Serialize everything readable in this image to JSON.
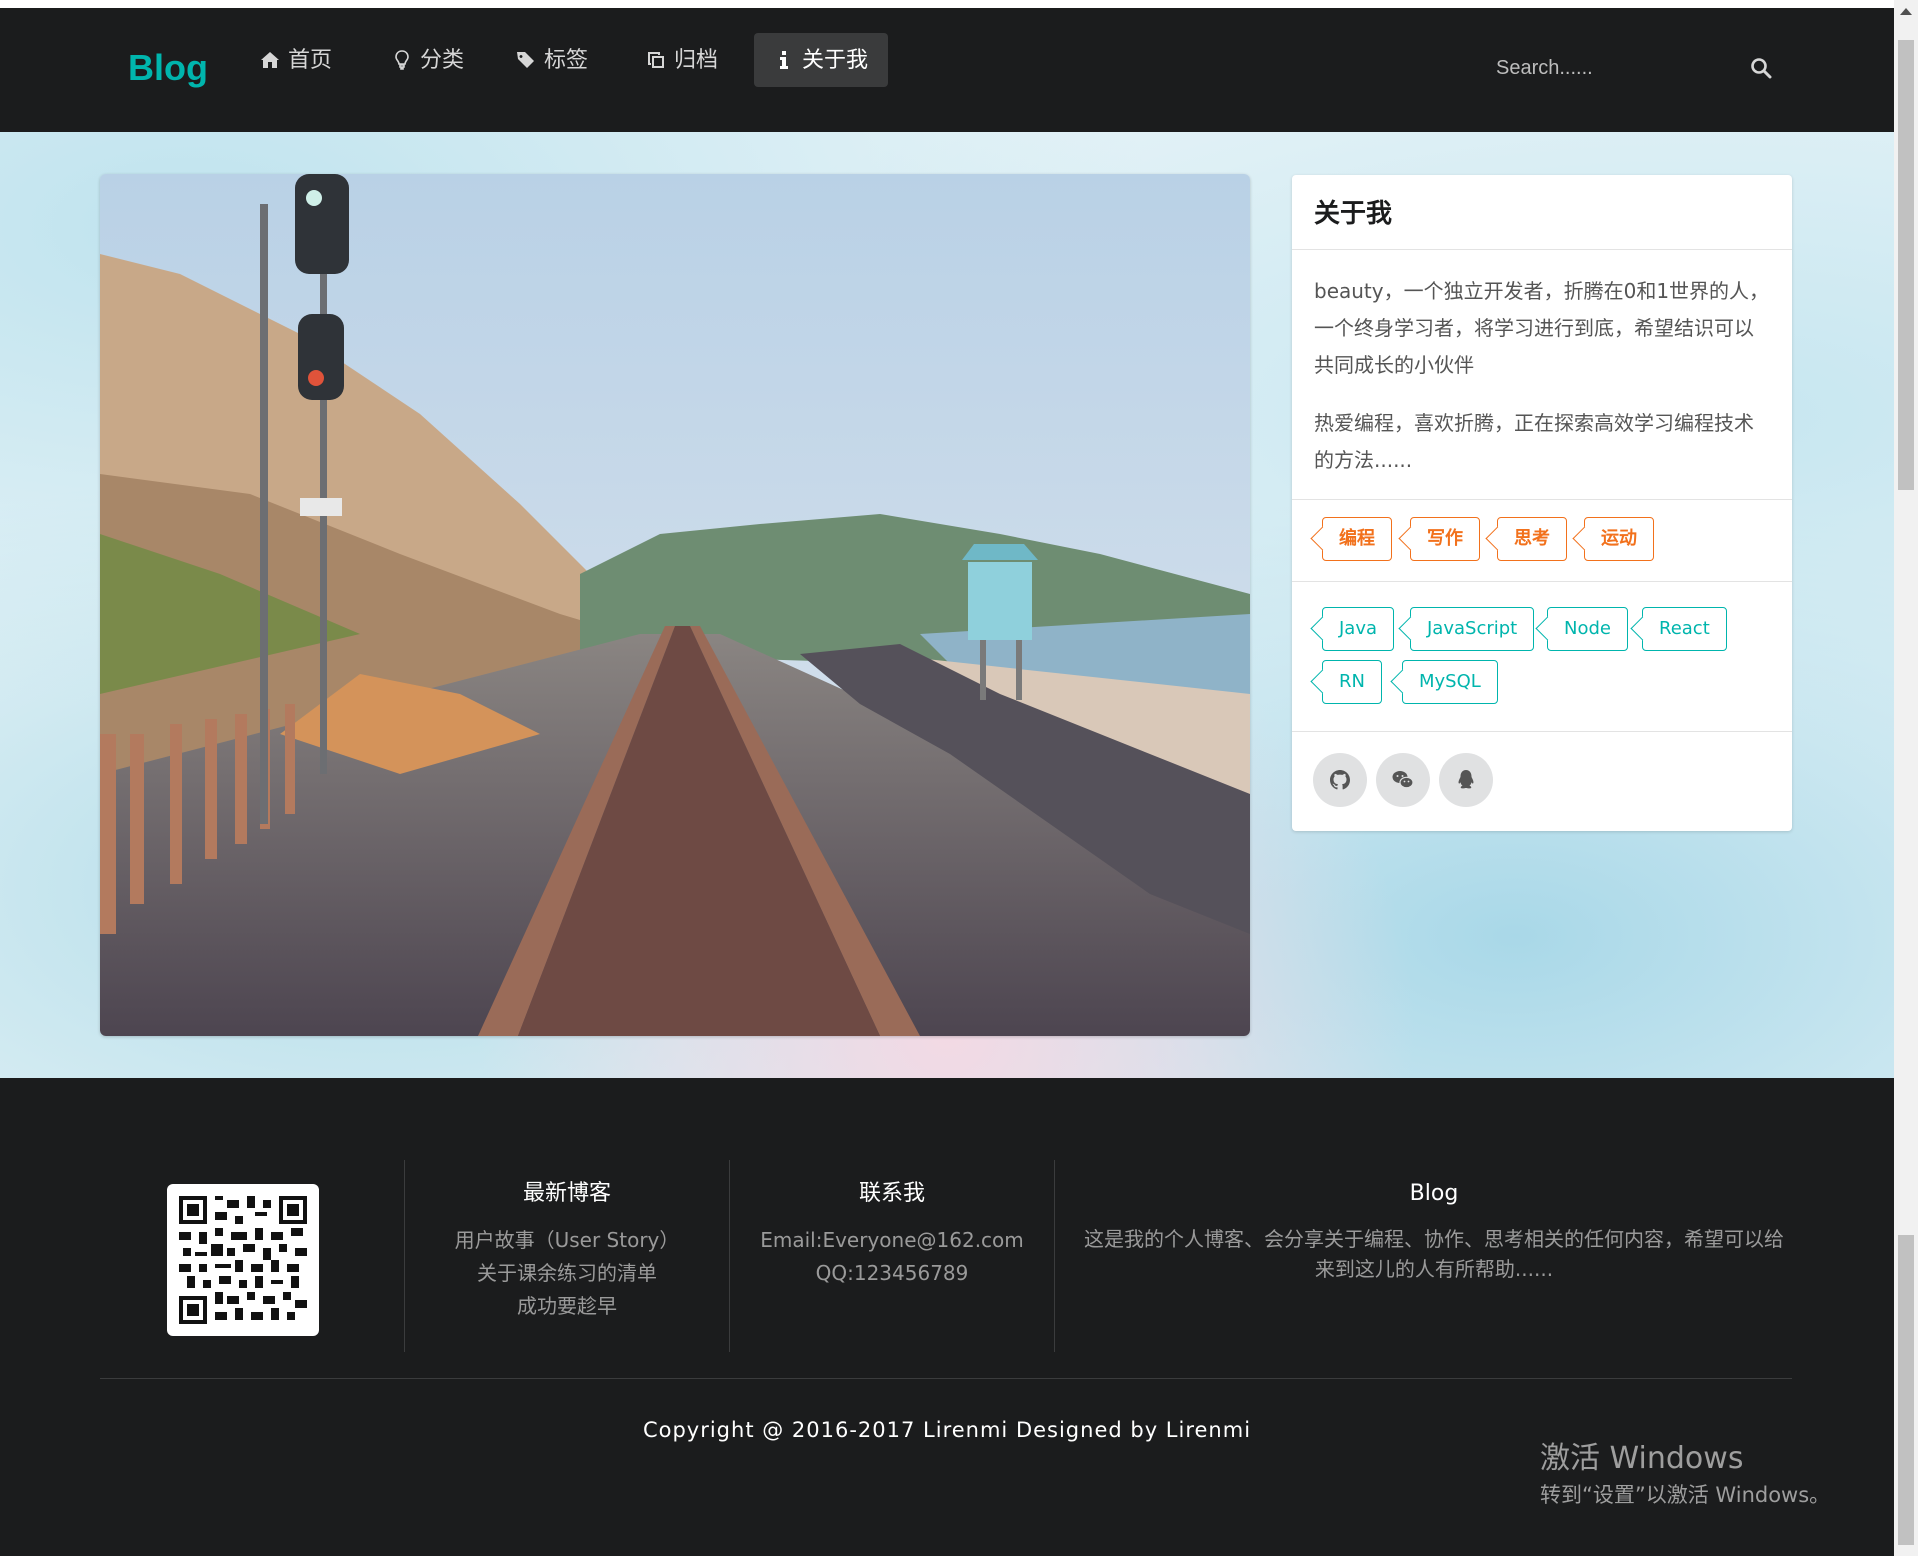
{
  "brand": "Blog",
  "nav": {
    "items": [
      {
        "label": "首页",
        "icon": "home-icon"
      },
      {
        "label": "分类",
        "icon": "lightbulb-icon"
      },
      {
        "label": "标签",
        "icon": "tags-icon"
      },
      {
        "label": "归档",
        "icon": "clone-icon"
      },
      {
        "label": "关于我",
        "icon": "info-icon",
        "active": true
      }
    ],
    "search_placeholder": "Search......"
  },
  "about": {
    "title": "关于我",
    "paragraph1": "beauty，一个独立开发者，折腾在0和1世界的人，一个终身学习者，将学习进行到底，希望结识可以共同成长的小伙伴",
    "paragraph2": "热爱编程，喜欢折腾，正在探索高效学习编程技术的方法......",
    "interest_tags": [
      "编程",
      "写作",
      "思考",
      "运动"
    ],
    "skill_tags": [
      "Java",
      "JavaScript",
      "Node",
      "React",
      "RN",
      "MySQL"
    ],
    "social": [
      "github-icon",
      "wechat-icon",
      "qq-icon"
    ]
  },
  "footer": {
    "latest": {
      "heading": "最新博客",
      "links": [
        "用户故事（User Story）",
        "关于课余练习的清单",
        "成功要趁早"
      ]
    },
    "contact": {
      "heading": "联系我",
      "email": "Email:Everyone@162.com",
      "qq": "QQ:123456789"
    },
    "blog": {
      "heading": "Blog",
      "text": "这是我的个人博客、会分享关于编程、协作、思考相关的任何内容，希望可以给来到这儿的人有所帮助......"
    },
    "copyright": "Copyright @ 2016-2017 Lirenmi Designed by Lirenmi"
  },
  "watermark": {
    "line1": "激活 Windows",
    "line2": "转到“设置”以激活 Windows。"
  },
  "colors": {
    "accent": "#00b5ad",
    "orange": "#f2711c",
    "navbar": "#1b1c1d"
  }
}
